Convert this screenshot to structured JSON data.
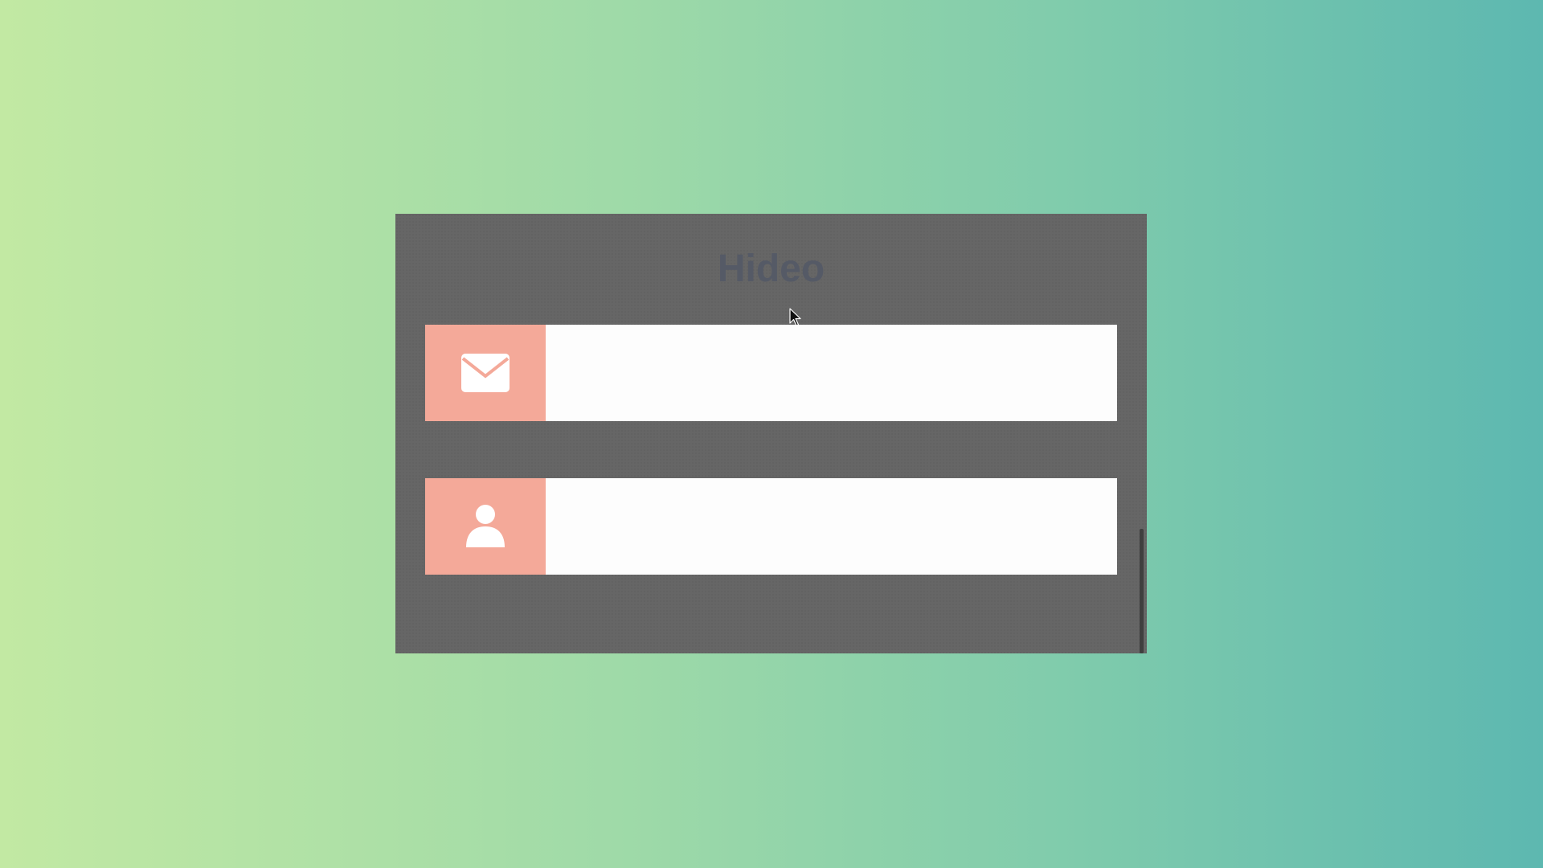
{
  "form": {
    "title": "Hideo",
    "fields": [
      {
        "icon": "envelope-icon",
        "value": "",
        "placeholder": ""
      },
      {
        "icon": "user-icon",
        "value": "",
        "placeholder": ""
      }
    ]
  },
  "colors": {
    "background_start": "#c2e9a3",
    "background_end": "#5db8b0",
    "panel": "#666666",
    "title": "#555a66",
    "icon_block": "#f4a999",
    "input": "#fdfdfd",
    "icon_glyph": "#ffffff"
  }
}
